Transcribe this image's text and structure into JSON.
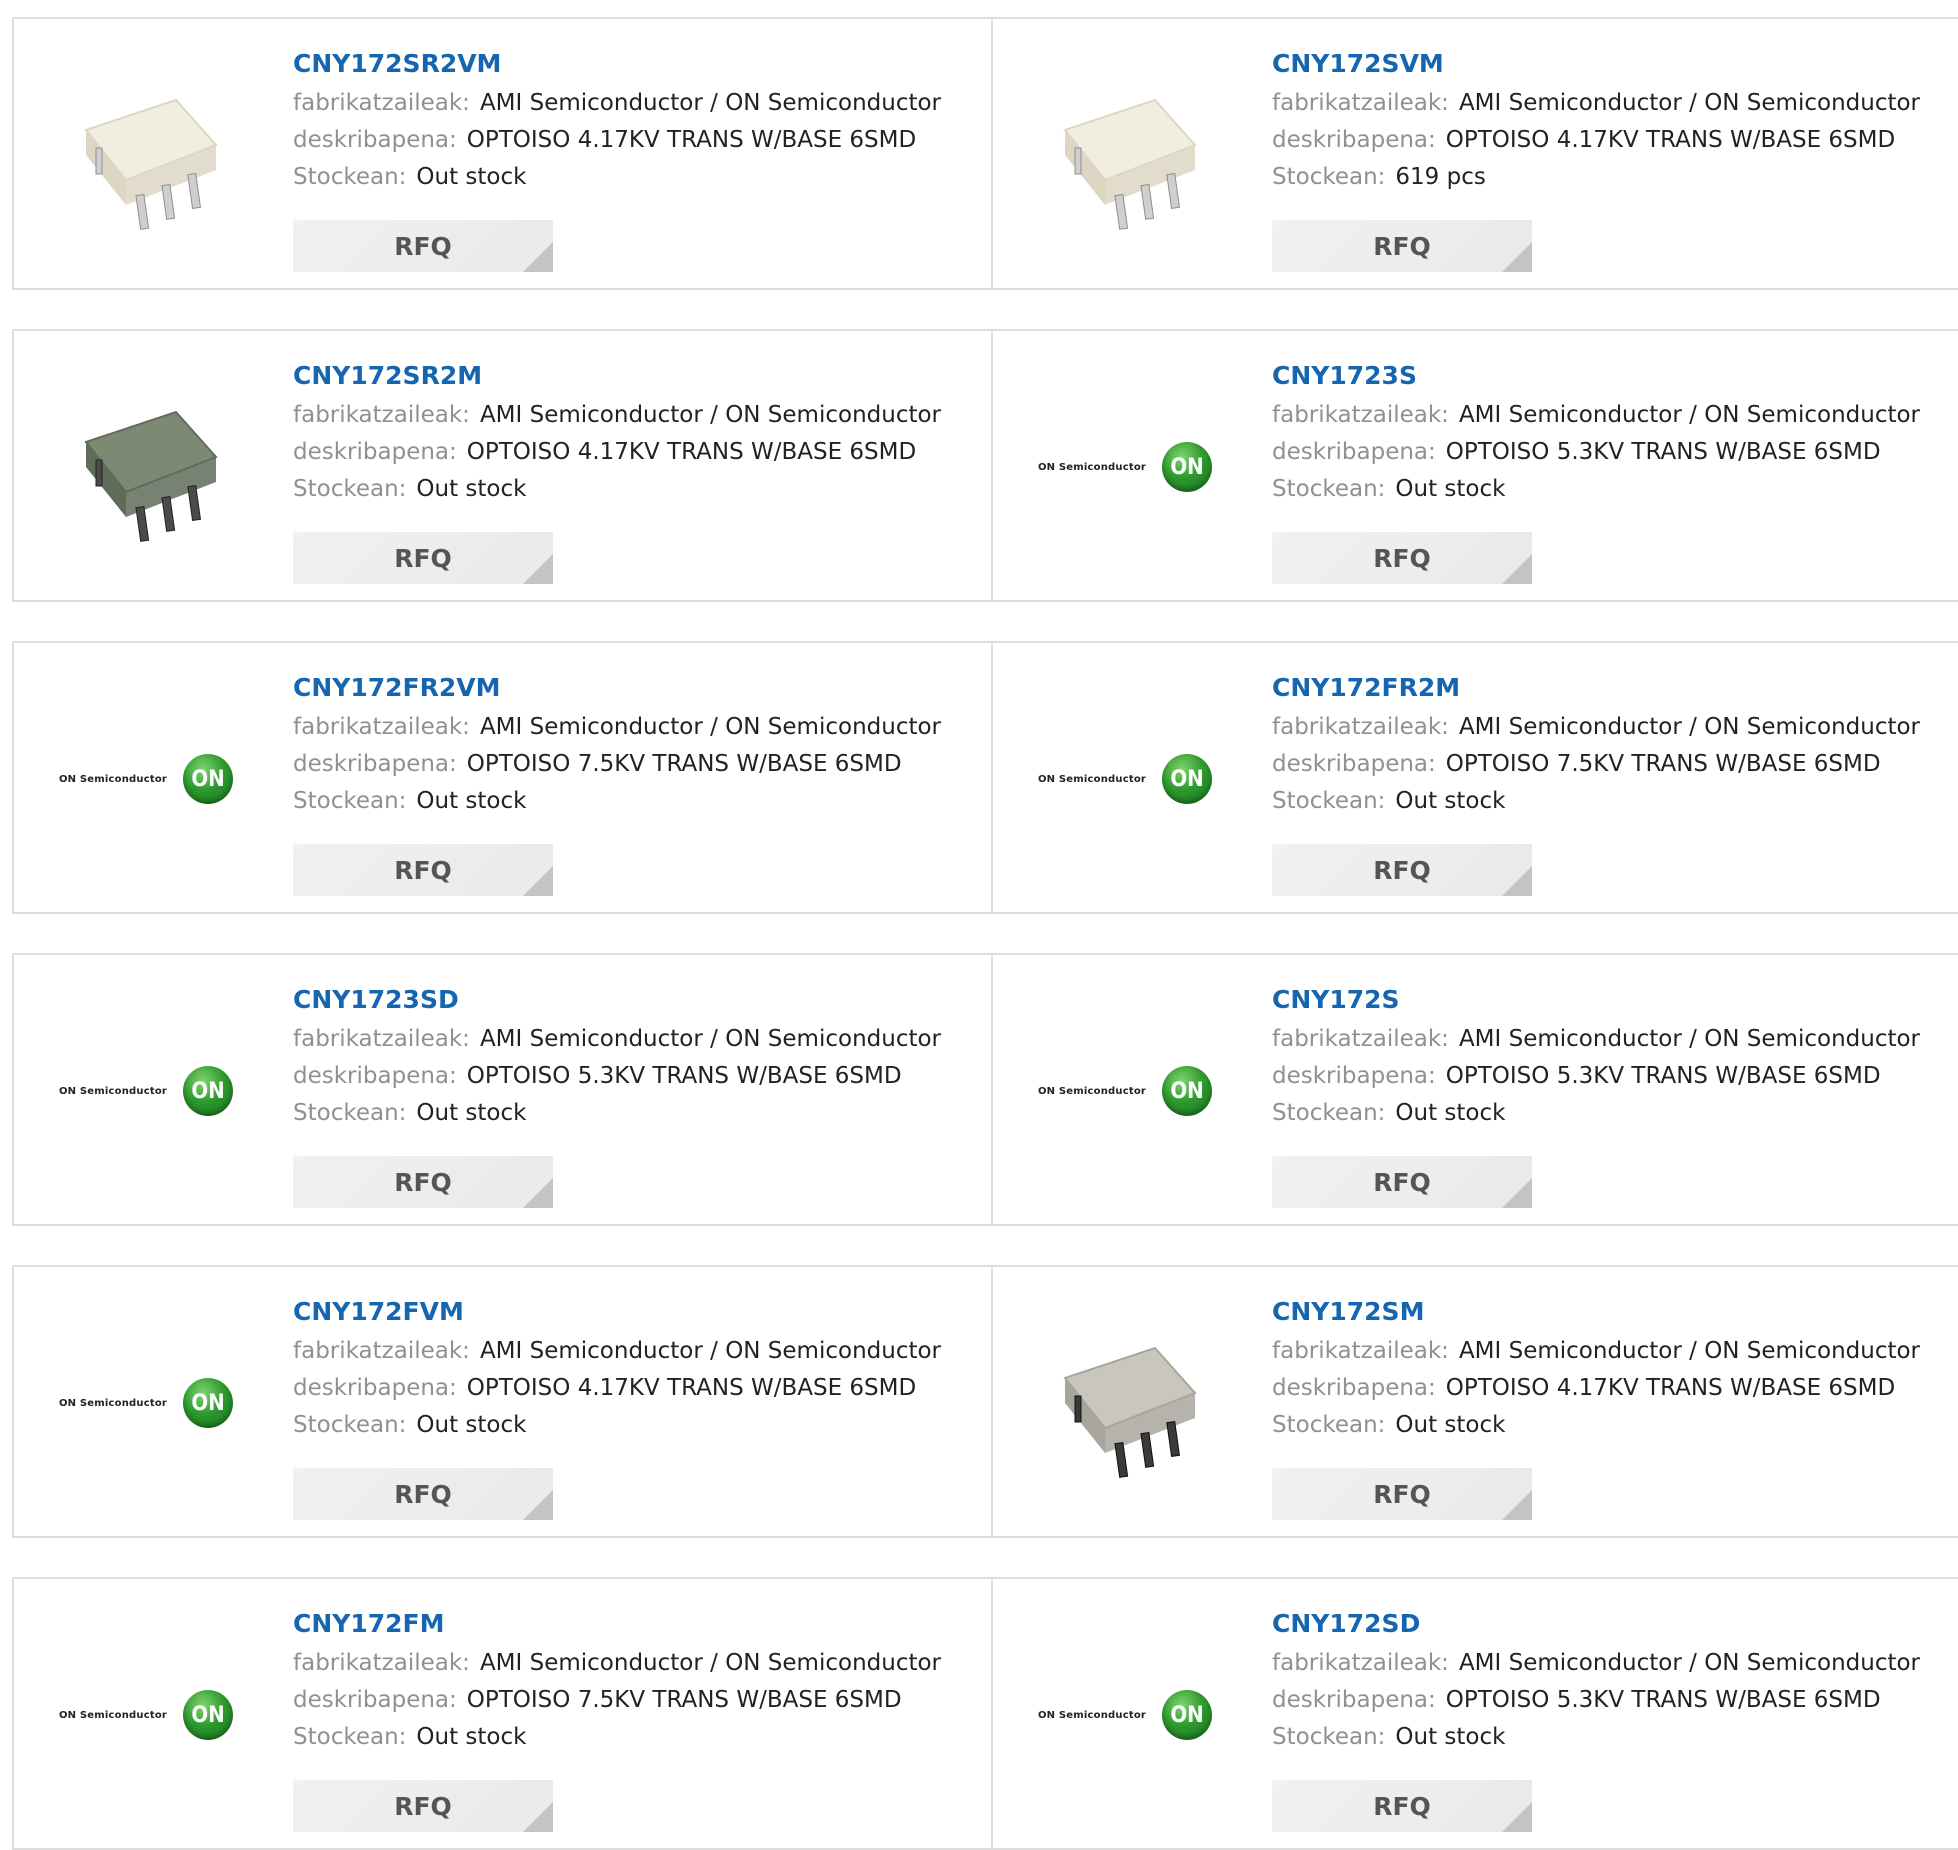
{
  "labels": {
    "manufacturer": "fabrikatzaileak:",
    "description": "deskribapena:",
    "stock": "Stockean:",
    "rfq": "RFQ"
  },
  "products": [
    {
      "part": "CNY172SR2VM",
      "manufacturer": "AMI Semiconductor / ON Semiconductor",
      "description": "OPTOISO 4.17KV TRANS W/BASE 6SMD",
      "stock": "Out stock",
      "image": "white-smd-package-image"
    },
    {
      "part": "CNY172SVM",
      "manufacturer": "AMI Semiconductor / ON Semiconductor",
      "description": "OPTOISO 4.17KV TRANS W/BASE 6SMD",
      "stock": "619 pcs",
      "image": "white-smd-package-image"
    },
    {
      "part": "CNY172SR2M",
      "manufacturer": "AMI Semiconductor / ON Semiconductor",
      "description": "OPTOISO 4.17KV TRANS W/BASE 6SMD",
      "stock": "Out stock",
      "image": "green-smd-package-image"
    },
    {
      "part": "CNY1723S",
      "manufacturer": "AMI Semiconductor / ON Semiconductor",
      "description": "OPTOISO 5.3KV TRANS W/BASE 6SMD",
      "stock": "Out stock",
      "image": "on-semiconductor-logo"
    },
    {
      "part": "CNY172FR2VM",
      "manufacturer": "AMI Semiconductor / ON Semiconductor",
      "description": "OPTOISO 7.5KV TRANS W/BASE 6SMD",
      "stock": "Out stock",
      "image": "on-semiconductor-logo"
    },
    {
      "part": "CNY172FR2M",
      "manufacturer": "AMI Semiconductor / ON Semiconductor",
      "description": "OPTOISO 7.5KV TRANS W/BASE 6SMD",
      "stock": "Out stock",
      "image": "on-semiconductor-logo"
    },
    {
      "part": "CNY1723SD",
      "manufacturer": "AMI Semiconductor / ON Semiconductor",
      "description": "OPTOISO 5.3KV TRANS W/BASE 6SMD",
      "stock": "Out stock",
      "image": "on-semiconductor-logo"
    },
    {
      "part": "CNY172S",
      "manufacturer": "AMI Semiconductor / ON Semiconductor",
      "description": "OPTOISO 5.3KV TRANS W/BASE 6SMD",
      "stock": "Out stock",
      "image": "on-semiconductor-logo"
    },
    {
      "part": "CNY172FVM",
      "manufacturer": "AMI Semiconductor / ON Semiconductor",
      "description": "OPTOISO 4.17KV TRANS W/BASE 6SMD",
      "stock": "Out stock",
      "image": "on-semiconductor-logo"
    },
    {
      "part": "CNY172SM",
      "manufacturer": "AMI Semiconductor / ON Semiconductor",
      "description": "OPTOISO 4.17KV TRANS W/BASE 6SMD",
      "stock": "Out stock",
      "image": "gray-smd-package-image"
    },
    {
      "part": "CNY172FM",
      "manufacturer": "AMI Semiconductor / ON Semiconductor",
      "description": "OPTOISO 7.5KV TRANS W/BASE 6SMD",
      "stock": "Out stock",
      "image": "on-semiconductor-logo"
    },
    {
      "part": "CNY172SD",
      "manufacturer": "AMI Semiconductor / ON Semiconductor",
      "description": "OPTOISO 5.3KV TRANS W/BASE 6SMD",
      "stock": "Out stock",
      "image": "on-semiconductor-logo"
    }
  ],
  "logo": {
    "wordmark": "ON Semiconductor",
    "mark": "ON"
  },
  "colors": {
    "part_link": "#1565b0",
    "label": "#909090",
    "value": "#222222",
    "border": "#dddddd",
    "rfq_bg": "#eeeeee",
    "logo_green": "#2f9a2f"
  }
}
